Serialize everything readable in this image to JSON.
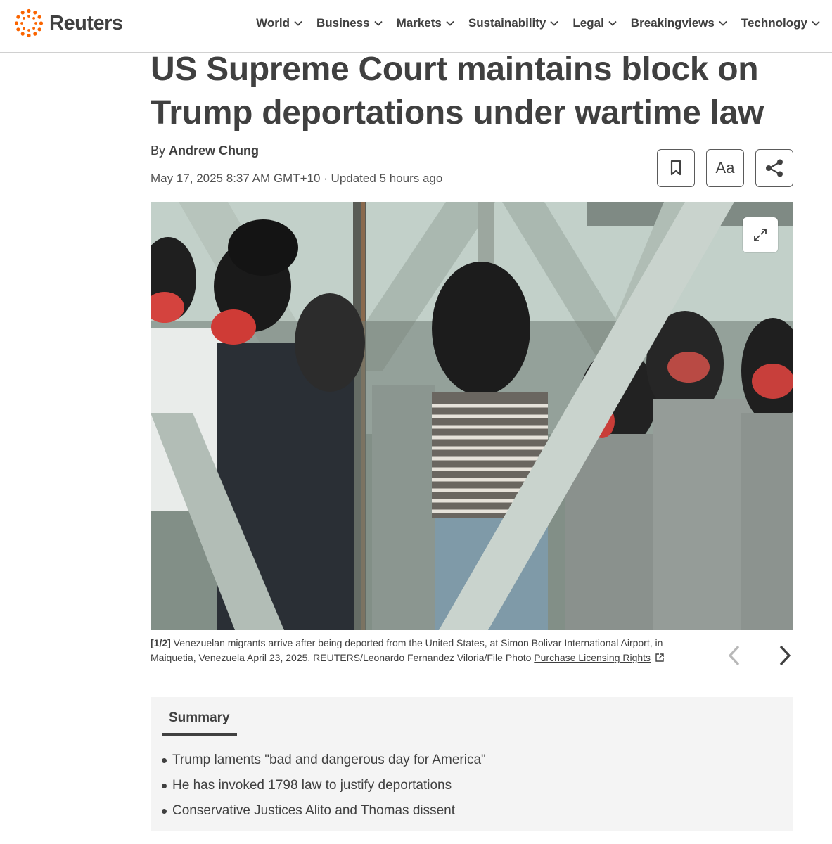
{
  "brand": {
    "name": "Reuters",
    "accent": "#fa6400"
  },
  "nav": {
    "items": [
      {
        "label": "World"
      },
      {
        "label": "Business"
      },
      {
        "label": "Markets"
      },
      {
        "label": "Sustainability"
      },
      {
        "label": "Legal"
      },
      {
        "label": "Breakingviews"
      },
      {
        "label": "Technology"
      }
    ]
  },
  "article": {
    "headline": "US Supreme Court maintains block on Trump deportations under wartime law",
    "byline_prefix": "By ",
    "author": "Andrew Chung",
    "dateline": "May 17, 2025 8:37 AM GMT+10 · Updated 5 hours ago",
    "tools": {
      "text_size_label": "Aa"
    }
  },
  "media": {
    "icons": [
      "bookmark-icon",
      "share-icon",
      "expand-icon",
      "chevron-left-icon",
      "chevron-right-icon",
      "external-link-icon"
    ],
    "caption_index": "[1/2]",
    "caption_text": " Venezuelan migrants arrive after being deported from the United States, at Simon Bolivar International Airport, in Maiquetia, Venezuela April 23, 2025. REUTERS/Leonardo Fernandez Viloria/File Photo ",
    "licensing_link": "Purchase Licensing Rights"
  },
  "summary": {
    "tab_label": "Summary",
    "items": [
      "Trump laments \"bad and dangerous day for America\"",
      "He has invoked 1798 law to justify deportations",
      "Conservative Justices Alito and Thomas dissent"
    ]
  }
}
